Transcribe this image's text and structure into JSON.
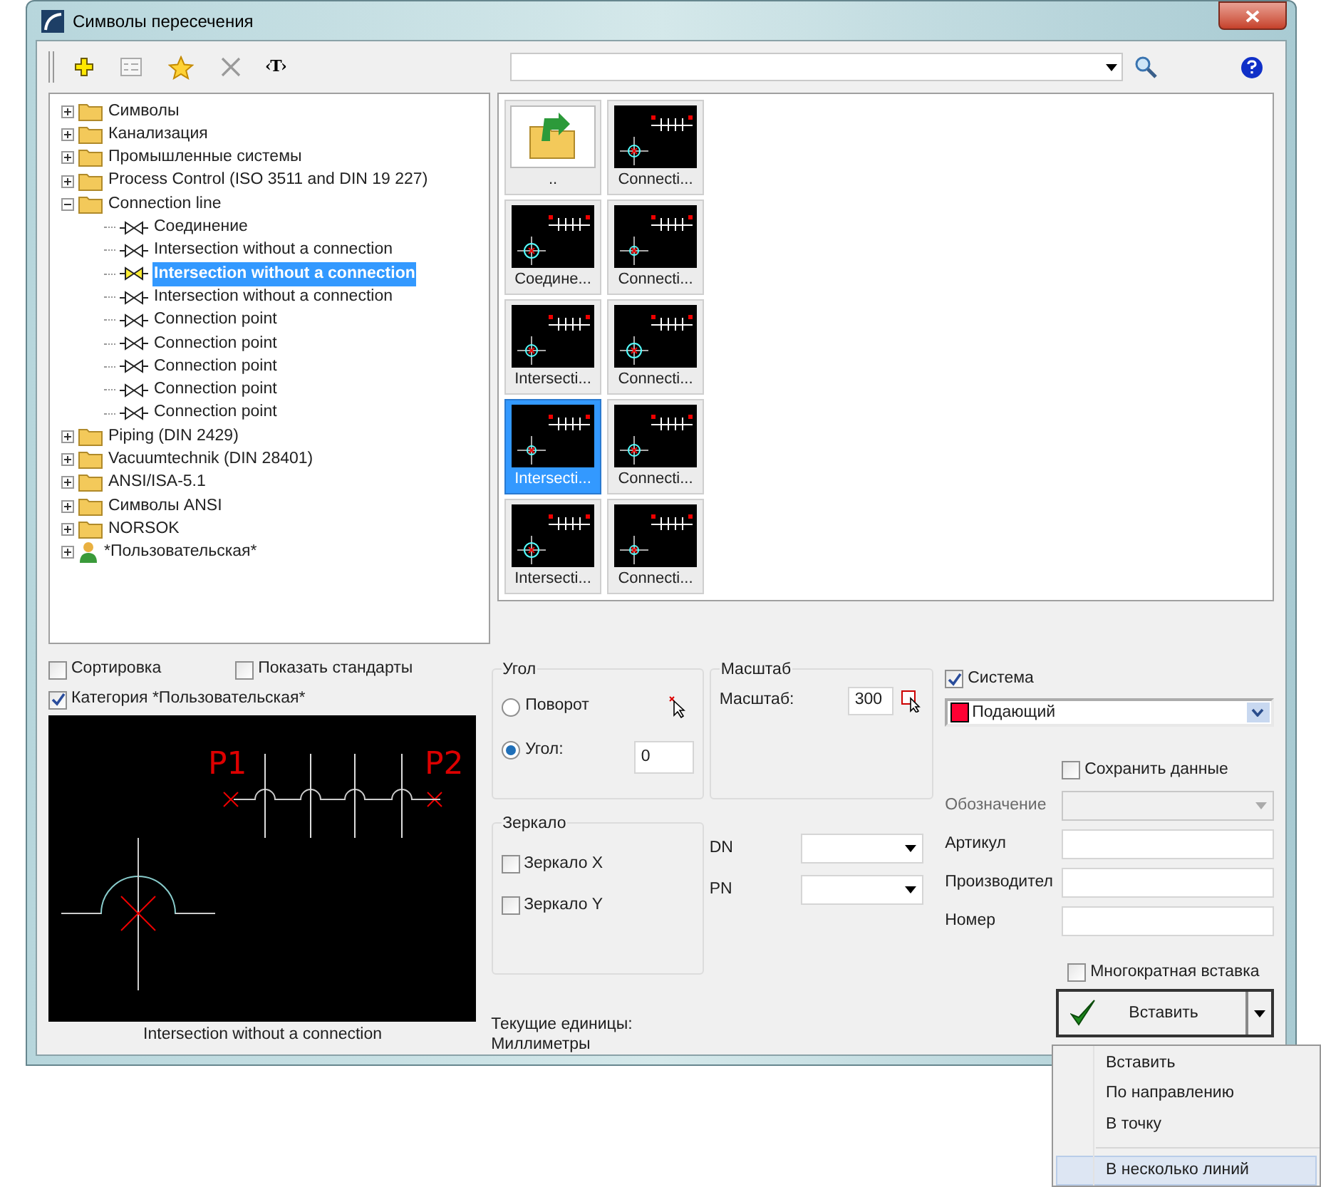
{
  "window": {
    "title": "Символы пересечения"
  },
  "toolbar": {
    "text_button": "‹T›"
  },
  "tree": [
    {
      "label": "Символы",
      "kind": "folder",
      "expanded": false,
      "selected": false
    },
    {
      "label": "Канализация",
      "kind": "folder",
      "expanded": false,
      "selected": false
    },
    {
      "label": "Промышленные системы",
      "kind": "folder",
      "expanded": false,
      "selected": false
    },
    {
      "label": "Process Control (ISO 3511 and DIN 19 227)",
      "kind": "folder",
      "expanded": false,
      "selected": false
    },
    {
      "label": "Connection line",
      "kind": "folder",
      "expanded": true,
      "selected": false,
      "children": [
        {
          "label": "Соединение",
          "kind": "symbol",
          "selected": false
        },
        {
          "label": "Intersection without a connection",
          "kind": "symbol",
          "selected": false
        },
        {
          "label": "Intersection without a connection",
          "kind": "symbol",
          "selected": true
        },
        {
          "label": "Intersection without a connection",
          "kind": "symbol",
          "selected": false
        },
        {
          "label": "Connection point",
          "kind": "symbol",
          "selected": false
        },
        {
          "label": "Connection point",
          "kind": "symbol",
          "selected": false
        },
        {
          "label": "Connection point",
          "kind": "symbol",
          "selected": false
        },
        {
          "label": "Connection point",
          "kind": "symbol",
          "selected": false
        },
        {
          "label": "Connection point",
          "kind": "symbol",
          "selected": false
        }
      ]
    },
    {
      "label": "Piping (DIN 2429)",
      "kind": "folder",
      "expanded": false,
      "selected": false
    },
    {
      "label": "Vacuumtechnik (DIN 28401)",
      "kind": "folder",
      "expanded": false,
      "selected": false
    },
    {
      "label": "ANSI/ISA-5.1",
      "kind": "folder",
      "expanded": false,
      "selected": false
    },
    {
      "label": "Символы ANSI",
      "kind": "folder",
      "expanded": false,
      "selected": false
    },
    {
      "label": "NORSOK",
      "kind": "folder",
      "expanded": false,
      "selected": false
    },
    {
      "label": "*Пользовательская*",
      "kind": "user",
      "expanded": false,
      "selected": false
    }
  ],
  "thumbnails": [
    {
      "label": "..",
      "kind": "folder",
      "selected": false
    },
    {
      "label": "Connecti...",
      "kind": "symbol",
      "selected": false
    },
    {
      "label": "Соедине...",
      "kind": "symbol",
      "selected": false
    },
    {
      "label": "Connecti...",
      "kind": "symbol",
      "selected": false
    },
    {
      "label": "Intersecti...",
      "kind": "symbol",
      "selected": false
    },
    {
      "label": "Connecti...",
      "kind": "symbol",
      "selected": false
    },
    {
      "label": "Intersecti...",
      "kind": "symbol",
      "selected": true
    },
    {
      "label": "Connecti...",
      "kind": "symbol",
      "selected": false
    },
    {
      "label": "Intersecti...",
      "kind": "symbol",
      "selected": false
    },
    {
      "label": "Connecti...",
      "kind": "symbol",
      "selected": false
    }
  ],
  "filters": [
    {
      "label": "Сортировка",
      "checked": false
    },
    {
      "label": "Показать стандарты",
      "checked": false
    },
    {
      "label": "Категория *Пользовательская*",
      "checked": true
    }
  ],
  "preview": {
    "points": [
      "P1",
      "P2"
    ],
    "caption": "Intersection without a connection"
  },
  "angle": {
    "title": "Угол",
    "options": [
      {
        "label": "Поворот",
        "selected": false
      },
      {
        "label": "Угол:",
        "selected": true
      }
    ],
    "value": "0"
  },
  "mirror": {
    "title": "Зеркало",
    "options": [
      {
        "label": "Зеркало X",
        "checked": false
      },
      {
        "label": "Зеркало Y",
        "checked": false
      }
    ]
  },
  "units": [
    "Текущие единицы:",
    "Миллиметры"
  ],
  "scale": {
    "title": "Масштаб",
    "label": "Масштаб:",
    "value": "300"
  },
  "dn": {
    "label": "DN"
  },
  "pn": {
    "label": "PN"
  },
  "system": {
    "label": "Система",
    "checked": true,
    "value": "Подающий",
    "color": "#ff0033"
  },
  "save_data": {
    "label": "Сохранить данные",
    "checked": false
  },
  "fields": [
    {
      "label": "Обозначение",
      "kind": "combo",
      "disabled": true
    },
    {
      "label": "Артикул",
      "kind": "text",
      "disabled": false
    },
    {
      "label": "Производител",
      "kind": "text",
      "disabled": false
    },
    {
      "label": "Номер",
      "kind": "text",
      "disabled": false
    }
  ],
  "multi_insert": {
    "label": "Многократная вставка",
    "checked": false
  },
  "insert_button": {
    "label": "Вставить"
  },
  "menu": [
    {
      "label": "Вставить",
      "selected": false,
      "separator_before": false
    },
    {
      "label": "По направлению",
      "selected": false,
      "separator_before": false
    },
    {
      "label": "В точку",
      "selected": false,
      "separator_before": false
    },
    {
      "label": "В несколько линий",
      "selected": true,
      "separator_before": true
    }
  ]
}
